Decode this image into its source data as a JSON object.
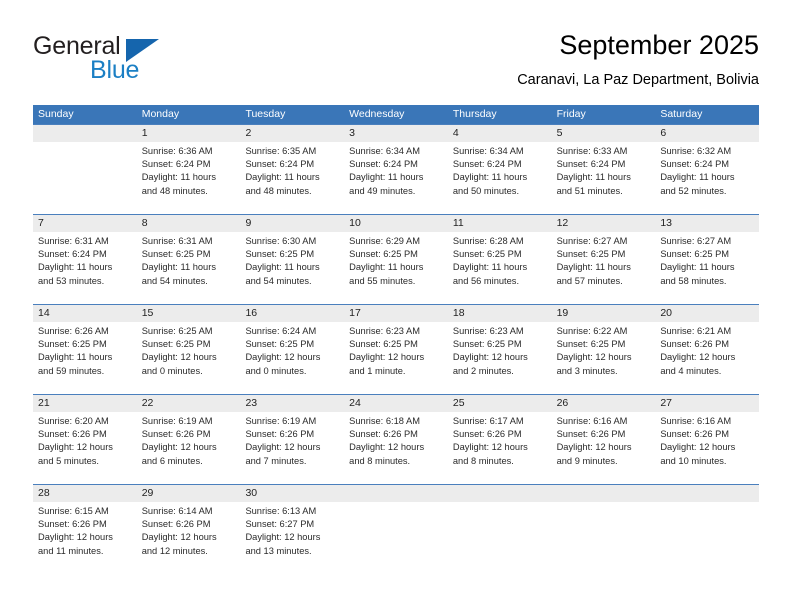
{
  "brand": {
    "name_part1": "General",
    "name_part2": "Blue",
    "triangle_icon": "triangle-icon",
    "accent_color": "#1565ad",
    "blue_text_color": "#1b7fc4"
  },
  "header": {
    "title": "September 2025",
    "subtitle": "Caranavi, La Paz Department, Bolivia"
  },
  "calendar": {
    "header_background": "#3a76b8",
    "daynum_band_background": "#ececec",
    "row_separator_color": "#4a7fbd",
    "weekdays": [
      "Sunday",
      "Monday",
      "Tuesday",
      "Wednesday",
      "Thursday",
      "Friday",
      "Saturday"
    ],
    "weeks": [
      {
        "days": [
          {
            "number": "",
            "empty": true,
            "sunrise": "",
            "sunset": "",
            "daylight_line1": "",
            "daylight_line2": ""
          },
          {
            "number": "1",
            "empty": false,
            "sunrise": "Sunrise: 6:36 AM",
            "sunset": "Sunset: 6:24 PM",
            "daylight_line1": "Daylight: 11 hours",
            "daylight_line2": "and 48 minutes."
          },
          {
            "number": "2",
            "empty": false,
            "sunrise": "Sunrise: 6:35 AM",
            "sunset": "Sunset: 6:24 PM",
            "daylight_line1": "Daylight: 11 hours",
            "daylight_line2": "and 48 minutes."
          },
          {
            "number": "3",
            "empty": false,
            "sunrise": "Sunrise: 6:34 AM",
            "sunset": "Sunset: 6:24 PM",
            "daylight_line1": "Daylight: 11 hours",
            "daylight_line2": "and 49 minutes."
          },
          {
            "number": "4",
            "empty": false,
            "sunrise": "Sunrise: 6:34 AM",
            "sunset": "Sunset: 6:24 PM",
            "daylight_line1": "Daylight: 11 hours",
            "daylight_line2": "and 50 minutes."
          },
          {
            "number": "5",
            "empty": false,
            "sunrise": "Sunrise: 6:33 AM",
            "sunset": "Sunset: 6:24 PM",
            "daylight_line1": "Daylight: 11 hours",
            "daylight_line2": "and 51 minutes."
          },
          {
            "number": "6",
            "empty": false,
            "sunrise": "Sunrise: 6:32 AM",
            "sunset": "Sunset: 6:24 PM",
            "daylight_line1": "Daylight: 11 hours",
            "daylight_line2": "and 52 minutes."
          }
        ]
      },
      {
        "days": [
          {
            "number": "7",
            "empty": false,
            "sunrise": "Sunrise: 6:31 AM",
            "sunset": "Sunset: 6:24 PM",
            "daylight_line1": "Daylight: 11 hours",
            "daylight_line2": "and 53 minutes."
          },
          {
            "number": "8",
            "empty": false,
            "sunrise": "Sunrise: 6:31 AM",
            "sunset": "Sunset: 6:25 PM",
            "daylight_line1": "Daylight: 11 hours",
            "daylight_line2": "and 54 minutes."
          },
          {
            "number": "9",
            "empty": false,
            "sunrise": "Sunrise: 6:30 AM",
            "sunset": "Sunset: 6:25 PM",
            "daylight_line1": "Daylight: 11 hours",
            "daylight_line2": "and 54 minutes."
          },
          {
            "number": "10",
            "empty": false,
            "sunrise": "Sunrise: 6:29 AM",
            "sunset": "Sunset: 6:25 PM",
            "daylight_line1": "Daylight: 11 hours",
            "daylight_line2": "and 55 minutes."
          },
          {
            "number": "11",
            "empty": false,
            "sunrise": "Sunrise: 6:28 AM",
            "sunset": "Sunset: 6:25 PM",
            "daylight_line1": "Daylight: 11 hours",
            "daylight_line2": "and 56 minutes."
          },
          {
            "number": "12",
            "empty": false,
            "sunrise": "Sunrise: 6:27 AM",
            "sunset": "Sunset: 6:25 PM",
            "daylight_line1": "Daylight: 11 hours",
            "daylight_line2": "and 57 minutes."
          },
          {
            "number": "13",
            "empty": false,
            "sunrise": "Sunrise: 6:27 AM",
            "sunset": "Sunset: 6:25 PM",
            "daylight_line1": "Daylight: 11 hours",
            "daylight_line2": "and 58 minutes."
          }
        ]
      },
      {
        "days": [
          {
            "number": "14",
            "empty": false,
            "sunrise": "Sunrise: 6:26 AM",
            "sunset": "Sunset: 6:25 PM",
            "daylight_line1": "Daylight: 11 hours",
            "daylight_line2": "and 59 minutes."
          },
          {
            "number": "15",
            "empty": false,
            "sunrise": "Sunrise: 6:25 AM",
            "sunset": "Sunset: 6:25 PM",
            "daylight_line1": "Daylight: 12 hours",
            "daylight_line2": "and 0 minutes."
          },
          {
            "number": "16",
            "empty": false,
            "sunrise": "Sunrise: 6:24 AM",
            "sunset": "Sunset: 6:25 PM",
            "daylight_line1": "Daylight: 12 hours",
            "daylight_line2": "and 0 minutes."
          },
          {
            "number": "17",
            "empty": false,
            "sunrise": "Sunrise: 6:23 AM",
            "sunset": "Sunset: 6:25 PM",
            "daylight_line1": "Daylight: 12 hours",
            "daylight_line2": "and 1 minute."
          },
          {
            "number": "18",
            "empty": false,
            "sunrise": "Sunrise: 6:23 AM",
            "sunset": "Sunset: 6:25 PM",
            "daylight_line1": "Daylight: 12 hours",
            "daylight_line2": "and 2 minutes."
          },
          {
            "number": "19",
            "empty": false,
            "sunrise": "Sunrise: 6:22 AM",
            "sunset": "Sunset: 6:25 PM",
            "daylight_line1": "Daylight: 12 hours",
            "daylight_line2": "and 3 minutes."
          },
          {
            "number": "20",
            "empty": false,
            "sunrise": "Sunrise: 6:21 AM",
            "sunset": "Sunset: 6:26 PM",
            "daylight_line1": "Daylight: 12 hours",
            "daylight_line2": "and 4 minutes."
          }
        ]
      },
      {
        "days": [
          {
            "number": "21",
            "empty": false,
            "sunrise": "Sunrise: 6:20 AM",
            "sunset": "Sunset: 6:26 PM",
            "daylight_line1": "Daylight: 12 hours",
            "daylight_line2": "and 5 minutes."
          },
          {
            "number": "22",
            "empty": false,
            "sunrise": "Sunrise: 6:19 AM",
            "sunset": "Sunset: 6:26 PM",
            "daylight_line1": "Daylight: 12 hours",
            "daylight_line2": "and 6 minutes."
          },
          {
            "number": "23",
            "empty": false,
            "sunrise": "Sunrise: 6:19 AM",
            "sunset": "Sunset: 6:26 PM",
            "daylight_line1": "Daylight: 12 hours",
            "daylight_line2": "and 7 minutes."
          },
          {
            "number": "24",
            "empty": false,
            "sunrise": "Sunrise: 6:18 AM",
            "sunset": "Sunset: 6:26 PM",
            "daylight_line1": "Daylight: 12 hours",
            "daylight_line2": "and 8 minutes."
          },
          {
            "number": "25",
            "empty": false,
            "sunrise": "Sunrise: 6:17 AM",
            "sunset": "Sunset: 6:26 PM",
            "daylight_line1": "Daylight: 12 hours",
            "daylight_line2": "and 8 minutes."
          },
          {
            "number": "26",
            "empty": false,
            "sunrise": "Sunrise: 6:16 AM",
            "sunset": "Sunset: 6:26 PM",
            "daylight_line1": "Daylight: 12 hours",
            "daylight_line2": "and 9 minutes."
          },
          {
            "number": "27",
            "empty": false,
            "sunrise": "Sunrise: 6:16 AM",
            "sunset": "Sunset: 6:26 PM",
            "daylight_line1": "Daylight: 12 hours",
            "daylight_line2": "and 10 minutes."
          }
        ]
      },
      {
        "days": [
          {
            "number": "28",
            "empty": false,
            "sunrise": "Sunrise: 6:15 AM",
            "sunset": "Sunset: 6:26 PM",
            "daylight_line1": "Daylight: 12 hours",
            "daylight_line2": "and 11 minutes."
          },
          {
            "number": "29",
            "empty": false,
            "sunrise": "Sunrise: 6:14 AM",
            "sunset": "Sunset: 6:26 PM",
            "daylight_line1": "Daylight: 12 hours",
            "daylight_line2": "and 12 minutes."
          },
          {
            "number": "30",
            "empty": false,
            "sunrise": "Sunrise: 6:13 AM",
            "sunset": "Sunset: 6:27 PM",
            "daylight_line1": "Daylight: 12 hours",
            "daylight_line2": "and 13 minutes."
          },
          {
            "number": "",
            "empty": true,
            "sunrise": "",
            "sunset": "",
            "daylight_line1": "",
            "daylight_line2": ""
          },
          {
            "number": "",
            "empty": true,
            "sunrise": "",
            "sunset": "",
            "daylight_line1": "",
            "daylight_line2": ""
          },
          {
            "number": "",
            "empty": true,
            "sunrise": "",
            "sunset": "",
            "daylight_line1": "",
            "daylight_line2": ""
          },
          {
            "number": "",
            "empty": true,
            "sunrise": "",
            "sunset": "",
            "daylight_line1": "",
            "daylight_line2": ""
          }
        ]
      }
    ]
  }
}
